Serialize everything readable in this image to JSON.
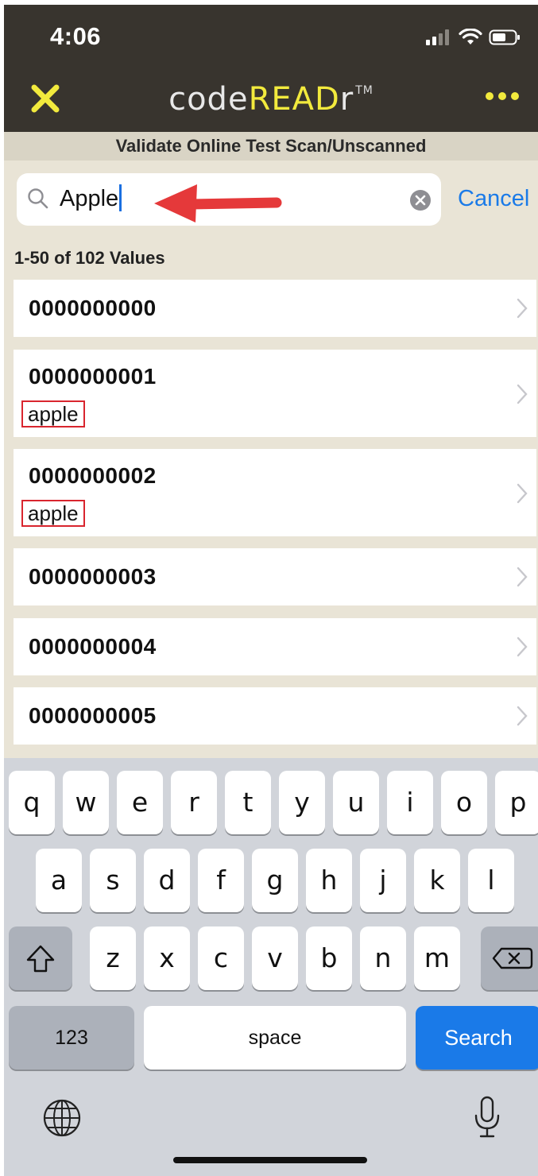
{
  "status_bar": {
    "time": "4:06"
  },
  "nav": {
    "logo_prefix": "code",
    "logo_accent": "READ",
    "logo_suffix": "r",
    "trademark": "TM",
    "colors": {
      "bar": "#38342e",
      "accent": "#f2ea3d"
    },
    "close_icon": "close-icon",
    "more_icon": "more-icon"
  },
  "subtitle": "Validate Online Test Scan/Unscanned",
  "search": {
    "value": "Apple",
    "cancel_label": "Cancel"
  },
  "results_count": "1-50 of 102 Values",
  "list": {
    "items": [
      {
        "code": "0000000000",
        "tag": ""
      },
      {
        "code": "0000000001",
        "tag": "apple"
      },
      {
        "code": "0000000002",
        "tag": "apple"
      },
      {
        "code": "0000000003",
        "tag": ""
      },
      {
        "code": "0000000004",
        "tag": ""
      },
      {
        "code": "0000000005",
        "tag": ""
      }
    ]
  },
  "keyboard": {
    "row1": [
      "q",
      "w",
      "e",
      "r",
      "t",
      "y",
      "u",
      "i",
      "o",
      "p"
    ],
    "row2": [
      "a",
      "s",
      "d",
      "f",
      "g",
      "h",
      "j",
      "k",
      "l"
    ],
    "row3": [
      "z",
      "x",
      "c",
      "v",
      "b",
      "n",
      "m"
    ],
    "numbers_label": "123",
    "space_label": "space",
    "search_label": "Search",
    "accent_color": "#1a7ae8"
  }
}
